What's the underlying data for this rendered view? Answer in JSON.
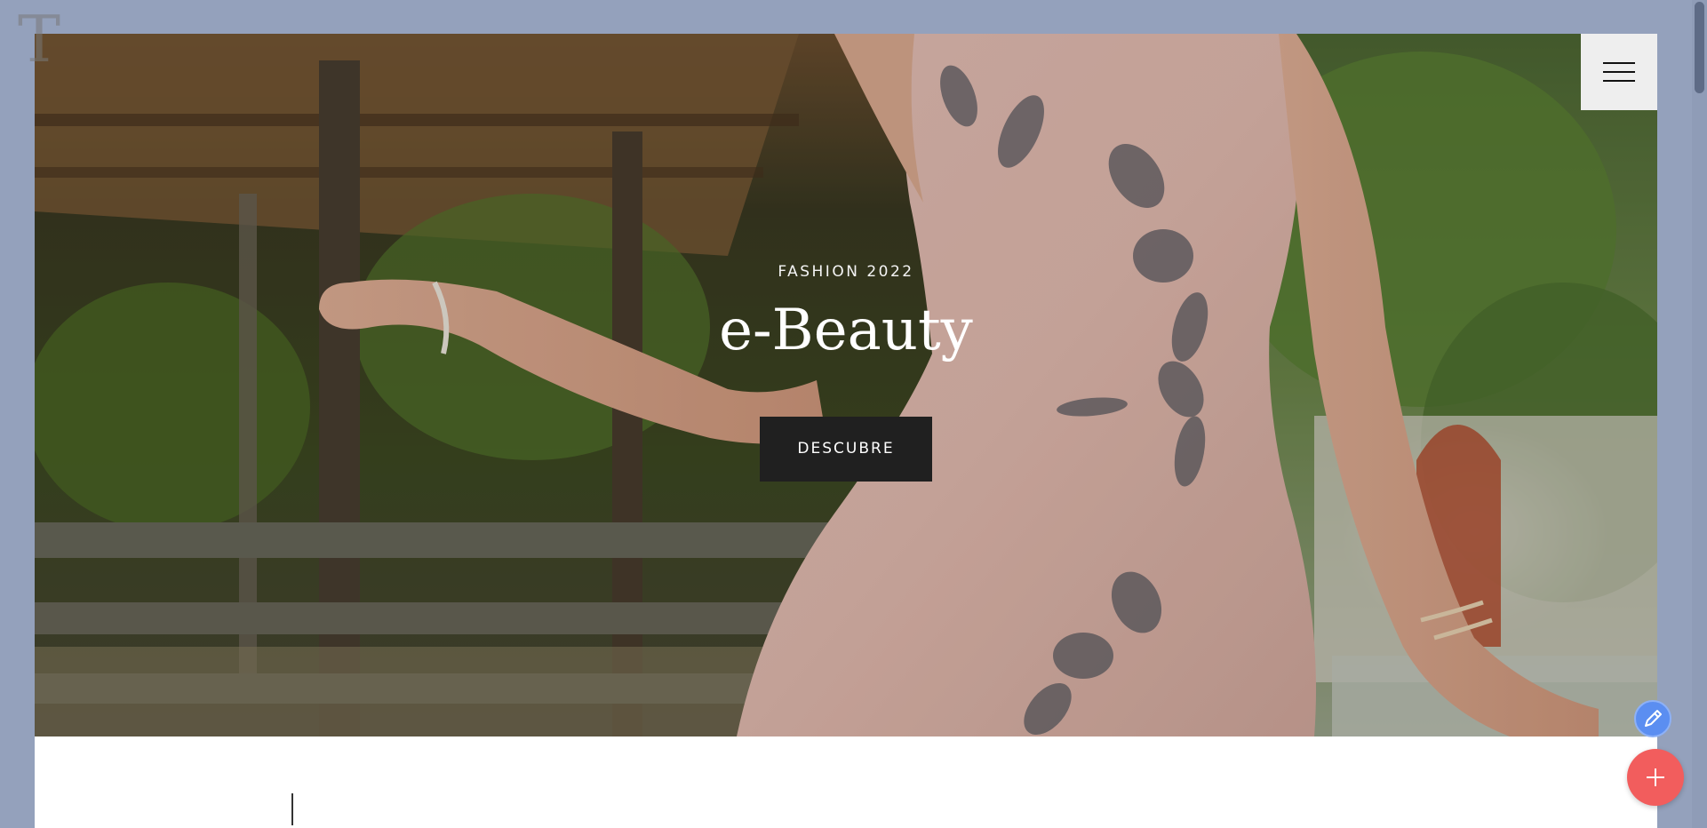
{
  "logo": {
    "letter": "T"
  },
  "hero": {
    "eyebrow": "FASHION 2022",
    "title": "e-Beauty",
    "cta_label": "DESCUBRE"
  },
  "menu": {
    "icon": "hamburger-icon"
  },
  "fab": {
    "edit_icon": "pencil-icon",
    "add_icon": "plus-icon"
  },
  "colors": {
    "page_background": "#94a1bc",
    "cta_background": "#202020",
    "edit_fab": "#5b8ef1",
    "add_fab": "#f25d5d"
  }
}
